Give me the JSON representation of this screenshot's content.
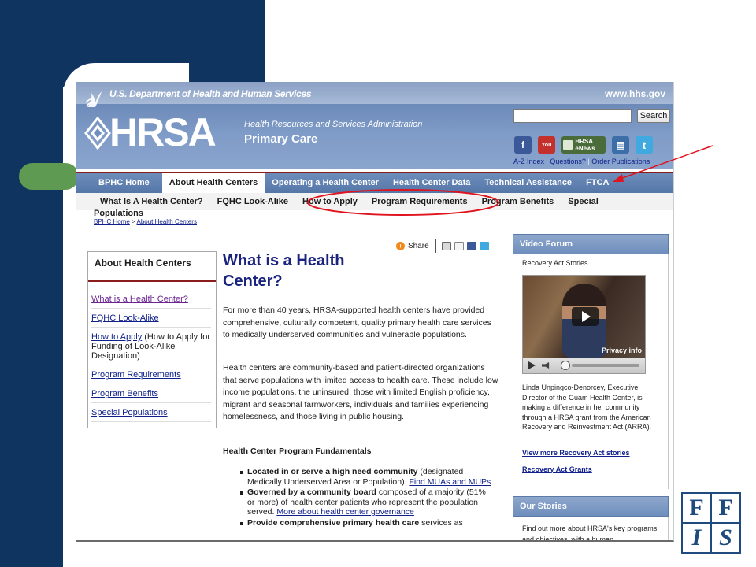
{
  "header": {
    "agency": "U.S. Department of Health and Human Services",
    "hhs_url": "www.hhs.gov",
    "logo_text": "HRSA",
    "full_name": "Health Resources and Services Administration",
    "subtitle": "Primary Care",
    "search_button": "Search",
    "enews_label": "HRSA eNews",
    "util_links": [
      "A-Z Index",
      "Questions?",
      "Order Publications"
    ]
  },
  "main_nav": [
    "BPHC Home",
    "About Health Centers",
    "Operating a Health Center",
    "Health Center Data",
    "Technical Assistance",
    "FTCA"
  ],
  "sub_nav": [
    "What Is A Health Center?",
    "FQHC Look-Alike",
    "How to Apply",
    "Program Requirements",
    "Program Benefits",
    "Special"
  ],
  "sub_nav_overflow": "Populations",
  "breadcrumb": {
    "items": [
      "BPHC Home",
      "About Health Centers"
    ],
    "separator": ">"
  },
  "left_sidebar": {
    "heading": "About Health Centers",
    "items": [
      {
        "link": "What is a Health Center?",
        "rest": ""
      },
      {
        "link": "FQHC Look-Alike",
        "rest": ""
      },
      {
        "link": "How to Apply",
        "rest": " (How to Apply for Funding of Look-Alike Designation)"
      },
      {
        "link": "Program Requirements",
        "rest": ""
      },
      {
        "link": "Program Benefits",
        "rest": ""
      },
      {
        "link": "Special Populations",
        "rest": ""
      }
    ]
  },
  "share_label": "Share",
  "main": {
    "title": "What is a Health Center?",
    "intro": "For more than 40 years, HRSA-supported health centers have provided comprehensive, culturally competent, quality primary health care services to medically underserved communities and vulnerable populations.",
    "centers": "Health centers are community-based and patient-directed organizations that serve populations with limited access to health care. These include low income populations, the uninsured, those with limited English proficiency, migrant and seasonal farmworkers, individuals and families experiencing homelessness, and those living in public housing.",
    "fundamentals_heading": "Health Center Program Fundamentals",
    "fundamentals": [
      {
        "bold": "Located in or serve a high need community",
        "text": " (designated Medically Underserved Area or Population). ",
        "link": "Find MUAs and MUPs"
      },
      {
        "bold": "Governed by a community board",
        "text": " composed of a majority (51% or more) of health center patients who represent the population served. ",
        "link": "More about health center governance"
      },
      {
        "bold": "Provide comprehensive primary health care",
        "text": " services as",
        "link": ""
      }
    ]
  },
  "video_forum": {
    "header": "Video Forum",
    "section_label": "Recovery Act Stories",
    "privacy": "Privacy info",
    "caption": "Linda Unpingco-Denorcey, Executive Director of the Guam Health Center, is making a difference in her community through a HRSA grant from the American Recovery and Reinvestment Act (ARRA).",
    "link_more": "View more Recovery Act stories",
    "link_grants": "Recovery Act Grants"
  },
  "our_stories": {
    "header": "Our Stories",
    "text": "Find out more about HRSA's key programs and objectives, with a human"
  },
  "ffis_logo": {
    "letters": [
      "F",
      "F",
      "I",
      "S"
    ]
  },
  "colors": {
    "slide_navy": "#0f3460",
    "slide_green": "#5f9a52",
    "nav_blue": "#5f80b0",
    "accent_red": "#8b1c1c",
    "annotation_red": "#e0141e",
    "link_blue": "#10218b"
  }
}
